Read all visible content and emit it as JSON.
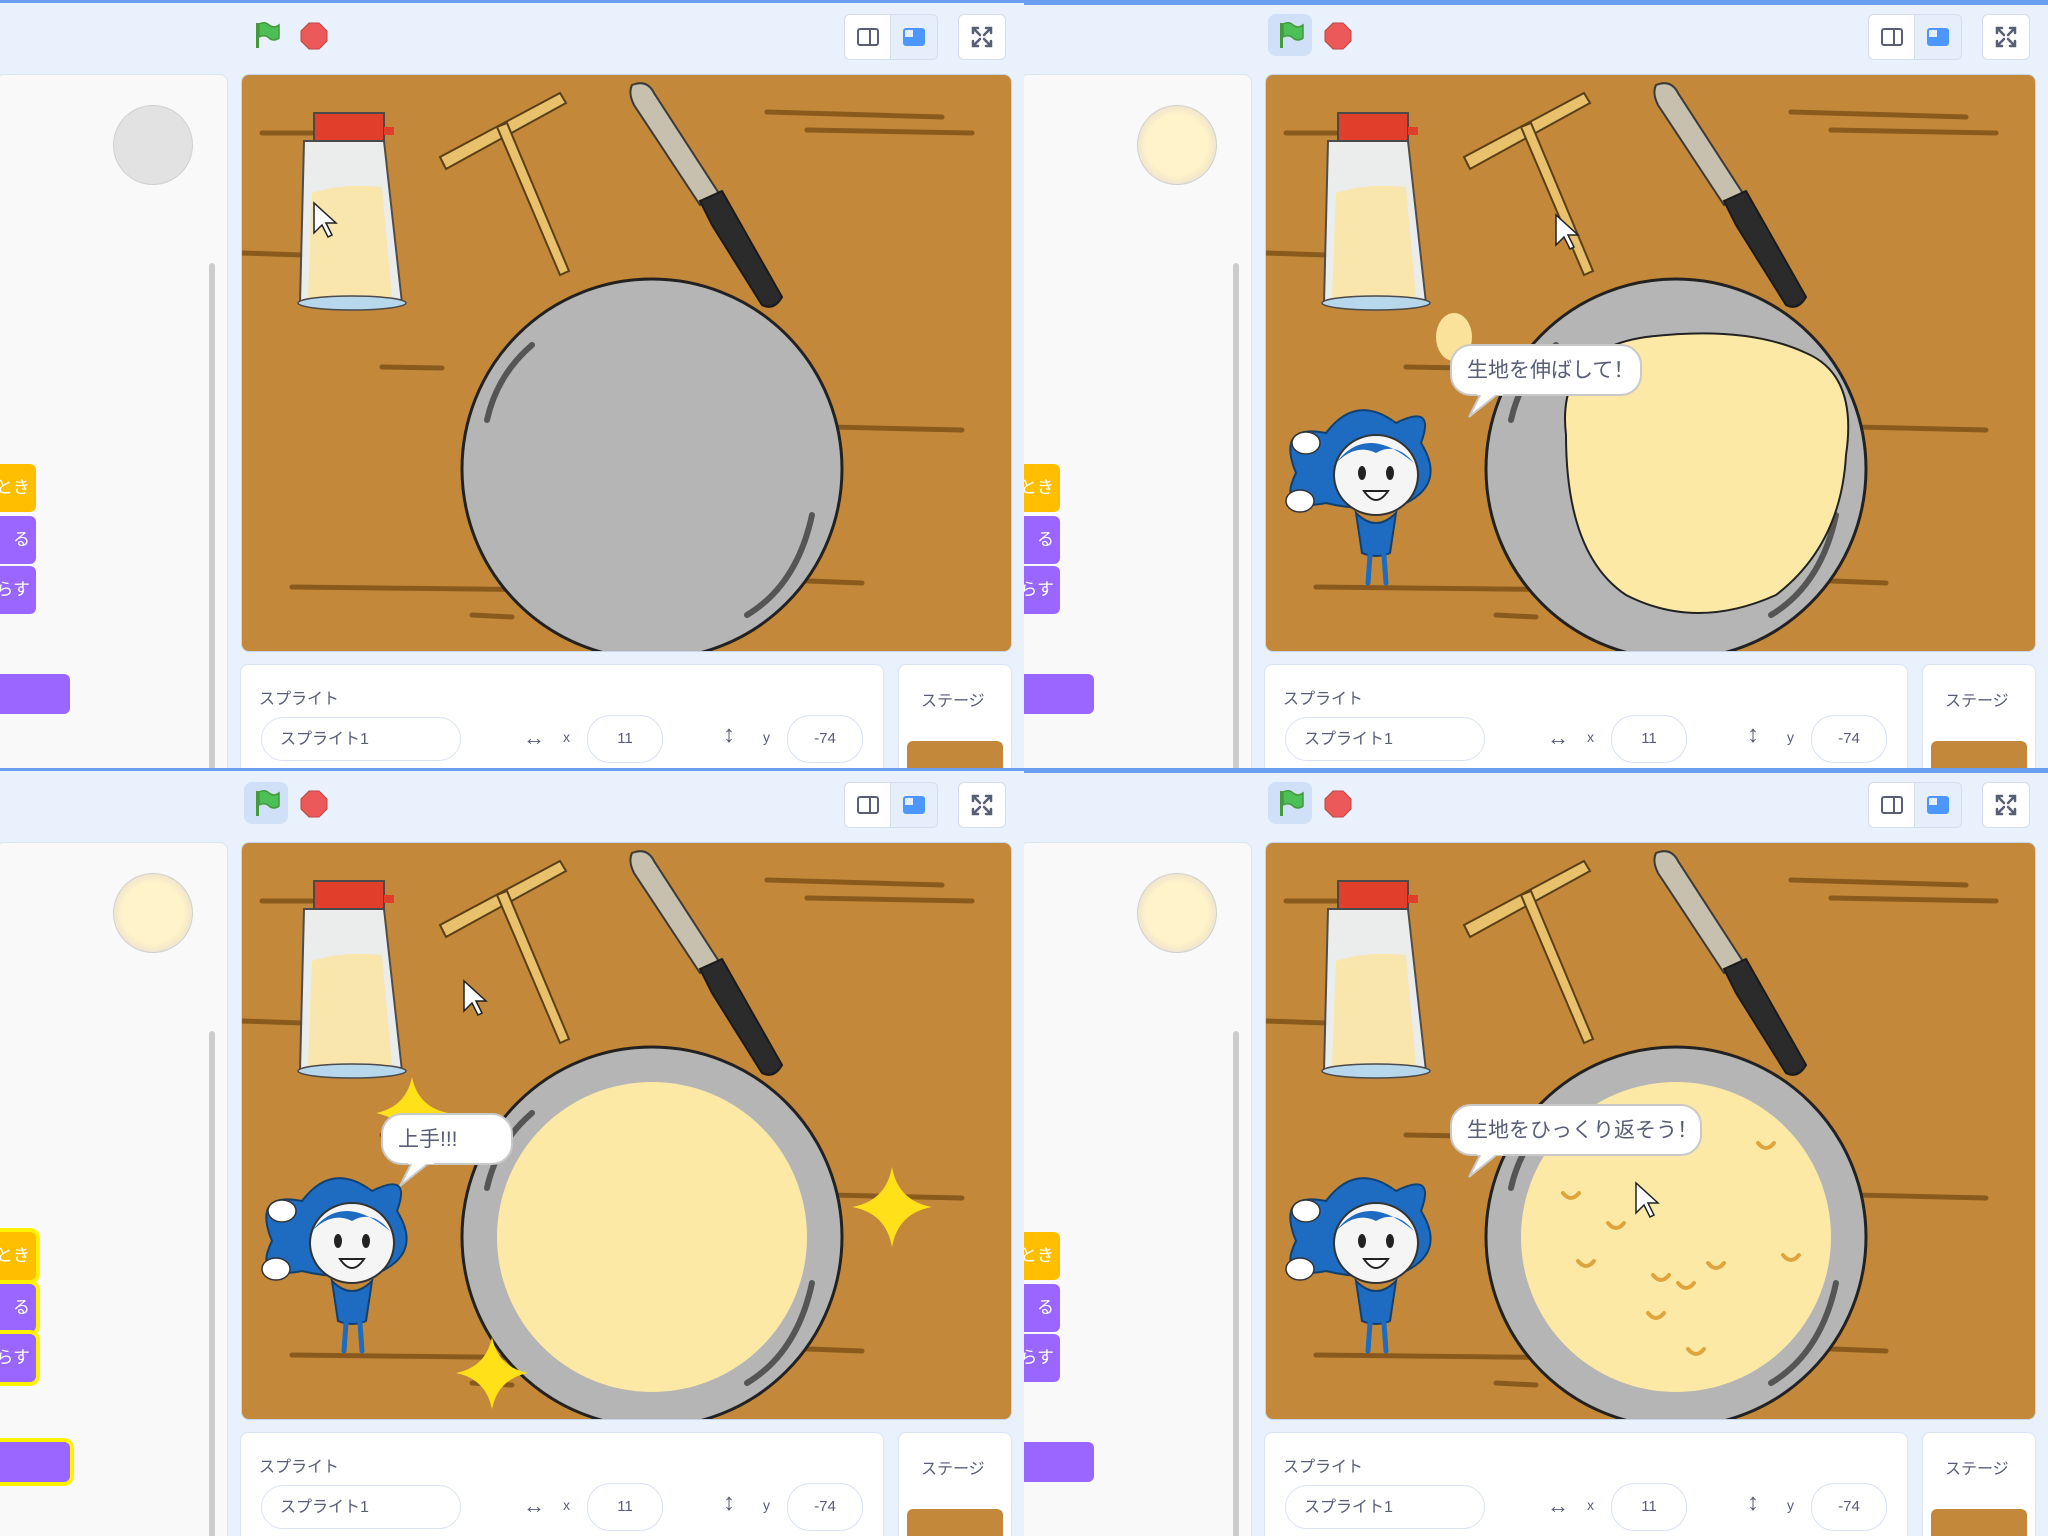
{
  "labels": {
    "sprite": "スプライト",
    "sprite_name": "スプライト1",
    "x": "x",
    "y": "y",
    "x_value": "11",
    "y_value": "-74",
    "stage": "ステージ"
  },
  "icons": {
    "green_flag": "green-flag-icon",
    "stop": "stop-icon",
    "small_stage": "small-stage-icon",
    "normal_stage": "normal-stage-icon",
    "fullscreen": "fullscreen-icon"
  },
  "colors": {
    "board": "#c4883a",
    "dough": "#fde9a6",
    "pan": "#b9b9b9",
    "event_block": "#ffbf00",
    "looks_block": "#9966ff",
    "mascot_blue": "#1d6cc1"
  },
  "frames": [
    {
      "flag_active": false,
      "stop_active": false,
      "speech": "",
      "dough": "none",
      "sparkles": false,
      "character": false,
      "highlight_blocks": false
    },
    {
      "flag_active": true,
      "stop_active": true,
      "speech": "生地を伸ばして！",
      "dough": "raw",
      "sparkles": false,
      "character": true,
      "highlight_blocks": false
    },
    {
      "flag_active": true,
      "stop_active": true,
      "speech": "上手!!!",
      "dough": "round",
      "sparkles": true,
      "character": true,
      "highlight_blocks": true
    },
    {
      "flag_active": true,
      "stop_active": true,
      "speech": "生地をひっくり返そう！",
      "dough": "bubbly",
      "sparkles": false,
      "character": true,
      "highlight_blocks": false
    }
  ],
  "block_fragments": [
    "とき",
    "る",
    "らす"
  ]
}
